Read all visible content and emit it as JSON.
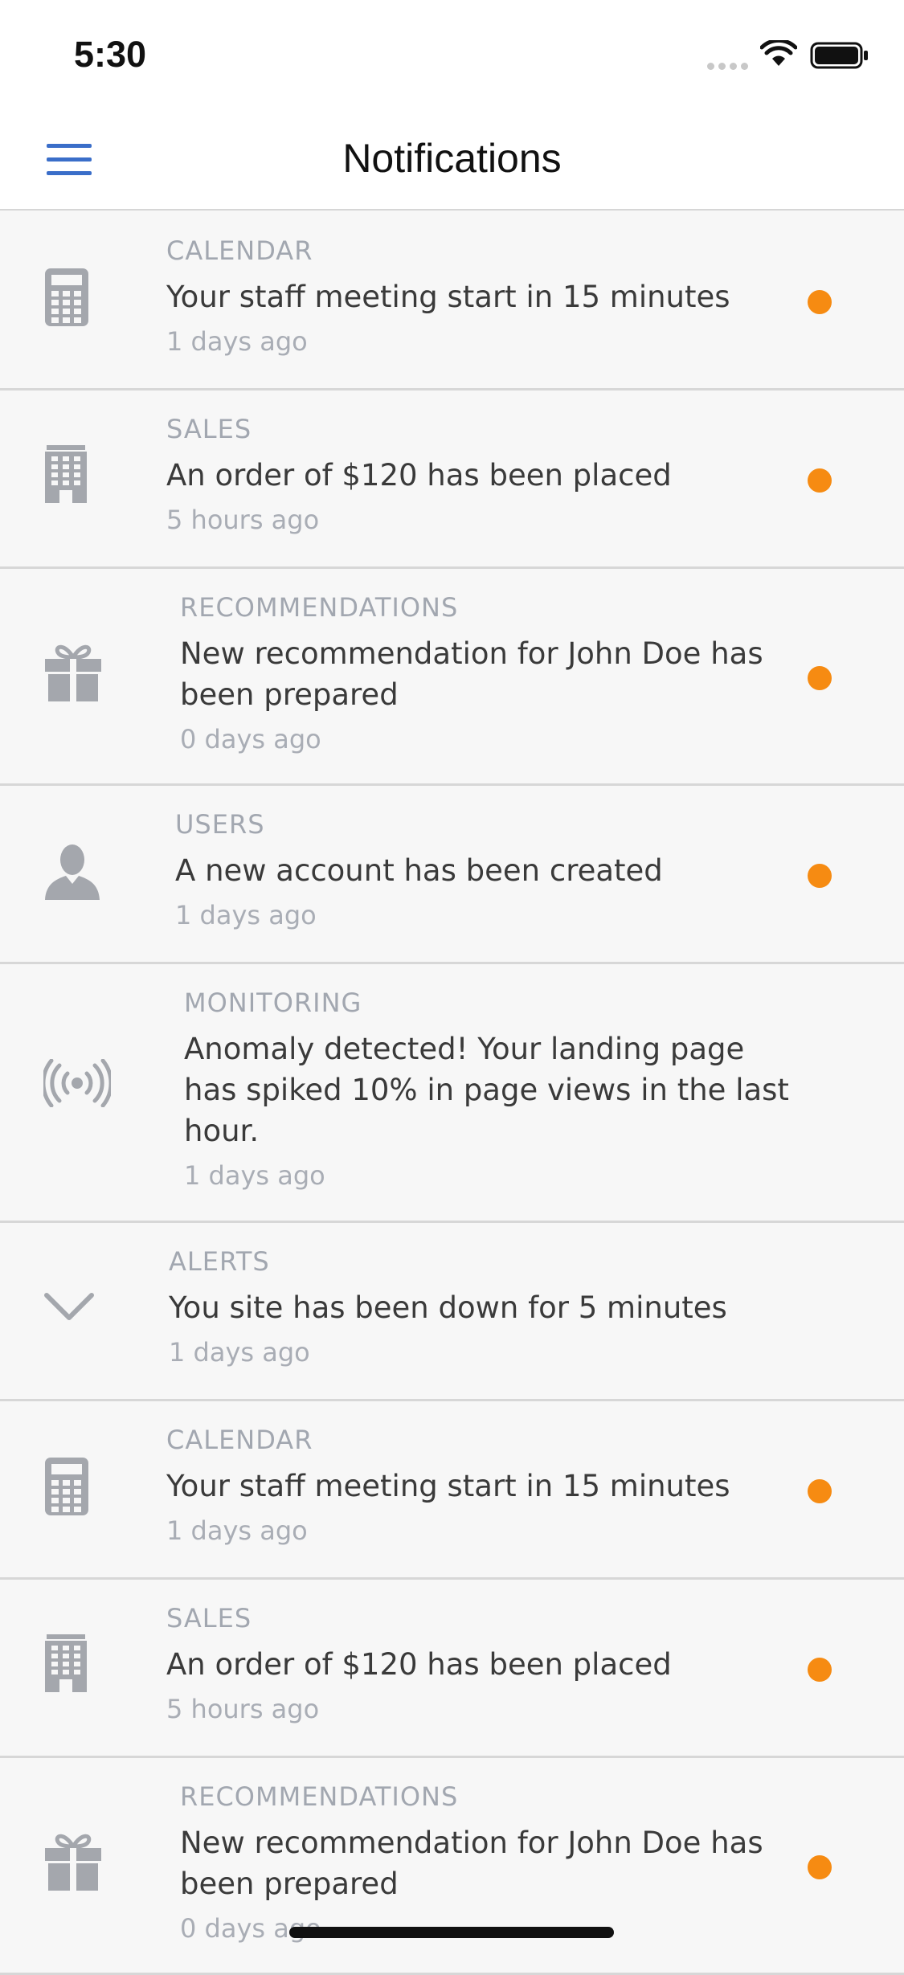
{
  "status_bar": {
    "time": "5:30"
  },
  "header": {
    "title": "Notifications",
    "menu_icon": "hamburger-menu-icon"
  },
  "colors": {
    "accent": "#3a6ec9",
    "unread": "#f68b12",
    "icon": "#a4a7ad"
  },
  "notifications": [
    {
      "category": "CALENDAR",
      "message": "Your staff meeting start in 15 minutes",
      "time": "1 days ago",
      "icon": "calculator-icon",
      "unread": true
    },
    {
      "category": "SALES",
      "message": "An order of $120 has been placed",
      "time": "5 hours ago",
      "icon": "building-icon",
      "unread": true
    },
    {
      "category": "RECOMMENDATIONS",
      "message": "New recommendation for John Doe has been prepared",
      "time": "0 days ago",
      "icon": "gift-icon",
      "unread": true
    },
    {
      "category": "USERS",
      "message": "A new account has been created",
      "time": "1 days ago",
      "icon": "user-icon",
      "unread": true
    },
    {
      "category": "MONITORING",
      "message": "Anomaly detected! Your landing page has spiked 10% in page views in the last hour.",
      "time": "1 days ago",
      "icon": "broadcast-icon",
      "unread": false
    },
    {
      "category": "ALERTS",
      "message": "You site has been down for 5 minutes",
      "time": "1 days ago",
      "icon": "chevron-down-icon",
      "unread": false
    },
    {
      "category": "CALENDAR",
      "message": "Your staff meeting start in 15 minutes",
      "time": "1 days ago",
      "icon": "calculator-icon",
      "unread": true
    },
    {
      "category": "SALES",
      "message": "An order of $120 has been placed",
      "time": "5 hours ago",
      "icon": "building-icon",
      "unread": true
    },
    {
      "category": "RECOMMENDATIONS",
      "message": "New recommendation for John Doe has been prepared",
      "time": "0 days ago",
      "icon": "gift-icon",
      "unread": true
    }
  ]
}
